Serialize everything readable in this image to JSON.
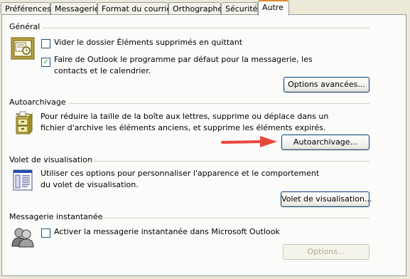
{
  "tabs": [
    {
      "label": "Préférences"
    },
    {
      "label": "Messagerie"
    },
    {
      "label": "Format du courrier"
    },
    {
      "label": "Orthographe"
    },
    {
      "label": "Sécurité"
    },
    {
      "label": "Autre",
      "active": true
    }
  ],
  "general": {
    "title": "Général",
    "option1": {
      "label": "Vider le dossier Éléments supprimés en quittant",
      "checked": false
    },
    "option2": {
      "label": "Faire de Outlook le programme par défaut pour la messagerie, les contacts et le calendrier.",
      "checked": true
    },
    "advanced_button": "Options avancées..."
  },
  "autoarchive": {
    "title": "Autoarchivage",
    "description": "Pour réduire la taille de la boîte aux lettres, supprime ou déplace dans un fichier d'archive les éléments anciens, et supprime les éléments expirés.",
    "button": "Autoarchivage..."
  },
  "reading_pane": {
    "title": "Volet de visualisation",
    "description": "Utiliser ces options pour personnaliser l'apparence et le comportement du volet de visualisation.",
    "button": "Volet de visualisation..."
  },
  "im": {
    "title": "Messagerie instantanée",
    "option": {
      "label": "Activer la messagerie instantanée dans Microsoft Outlook",
      "checked": false
    },
    "options_button": "Options...",
    "options_enabled": false
  },
  "colors": {
    "accent_tab": "#e68b2c",
    "arrow": "#e8483d",
    "border": "#919b9c"
  }
}
